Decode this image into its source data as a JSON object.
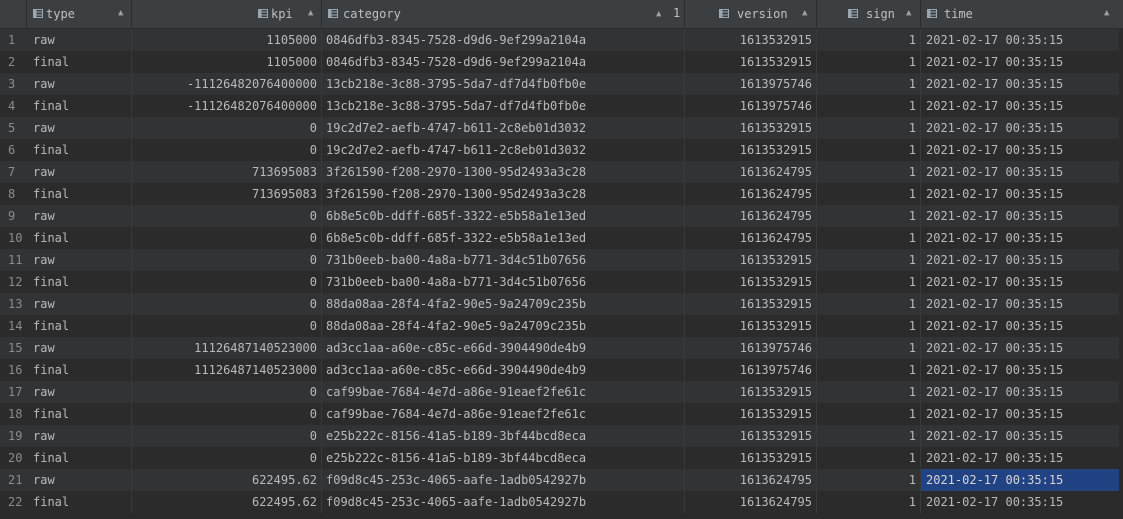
{
  "colors": {
    "background": "#2b2b2b",
    "row_alt": "#313335",
    "header": "#3c3f41",
    "selection": "#214283",
    "text": "#bababa",
    "row_number": "#8c8c8c"
  },
  "headers": {
    "type": "type",
    "kpi": "kpi",
    "category": "category",
    "version": "version",
    "sign": "sign",
    "time": "time",
    "sort_order": "1",
    "column_icon": "table-column-icon",
    "sort_icon": "sort-arrows-icon",
    "sort_asc_icon": "sort-ascending-icon"
  },
  "rows": [
    {
      "n": "1",
      "type": "raw",
      "kpi": "1105000",
      "category": "0846dfb3-8345-7528-d9d6-9ef299a2104a",
      "version": "1613532915",
      "sign": "1",
      "time": "2021-02-17 00:35:15"
    },
    {
      "n": "2",
      "type": "final",
      "kpi": "1105000",
      "category": "0846dfb3-8345-7528-d9d6-9ef299a2104a",
      "version": "1613532915",
      "sign": "1",
      "time": "2021-02-17 00:35:15"
    },
    {
      "n": "3",
      "type": "raw",
      "kpi": "-11126482076400000",
      "category": "13cb218e-3c88-3795-5da7-df7d4fb0fb0e",
      "version": "1613975746",
      "sign": "1",
      "time": "2021-02-17 00:35:15"
    },
    {
      "n": "4",
      "type": "final",
      "kpi": "-11126482076400000",
      "category": "13cb218e-3c88-3795-5da7-df7d4fb0fb0e",
      "version": "1613975746",
      "sign": "1",
      "time": "2021-02-17 00:35:15"
    },
    {
      "n": "5",
      "type": "raw",
      "kpi": "0",
      "category": "19c2d7e2-aefb-4747-b611-2c8eb01d3032",
      "version": "1613532915",
      "sign": "1",
      "time": "2021-02-17 00:35:15"
    },
    {
      "n": "6",
      "type": "final",
      "kpi": "0",
      "category": "19c2d7e2-aefb-4747-b611-2c8eb01d3032",
      "version": "1613532915",
      "sign": "1",
      "time": "2021-02-17 00:35:15"
    },
    {
      "n": "7",
      "type": "raw",
      "kpi": "713695083",
      "category": "3f261590-f208-2970-1300-95d2493a3c28",
      "version": "1613624795",
      "sign": "1",
      "time": "2021-02-17 00:35:15"
    },
    {
      "n": "8",
      "type": "final",
      "kpi": "713695083",
      "category": "3f261590-f208-2970-1300-95d2493a3c28",
      "version": "1613624795",
      "sign": "1",
      "time": "2021-02-17 00:35:15"
    },
    {
      "n": "9",
      "type": "raw",
      "kpi": "0",
      "category": "6b8e5c0b-ddff-685f-3322-e5b58a1e13ed",
      "version": "1613624795",
      "sign": "1",
      "time": "2021-02-17 00:35:15"
    },
    {
      "n": "10",
      "type": "final",
      "kpi": "0",
      "category": "6b8e5c0b-ddff-685f-3322-e5b58a1e13ed",
      "version": "1613624795",
      "sign": "1",
      "time": "2021-02-17 00:35:15"
    },
    {
      "n": "11",
      "type": "raw",
      "kpi": "0",
      "category": "731b0eeb-ba00-4a8a-b771-3d4c51b07656",
      "version": "1613532915",
      "sign": "1",
      "time": "2021-02-17 00:35:15"
    },
    {
      "n": "12",
      "type": "final",
      "kpi": "0",
      "category": "731b0eeb-ba00-4a8a-b771-3d4c51b07656",
      "version": "1613532915",
      "sign": "1",
      "time": "2021-02-17 00:35:15"
    },
    {
      "n": "13",
      "type": "raw",
      "kpi": "0",
      "category": "88da08aa-28f4-4fa2-90e5-9a24709c235b",
      "version": "1613532915",
      "sign": "1",
      "time": "2021-02-17 00:35:15"
    },
    {
      "n": "14",
      "type": "final",
      "kpi": "0",
      "category": "88da08aa-28f4-4fa2-90e5-9a24709c235b",
      "version": "1613532915",
      "sign": "1",
      "time": "2021-02-17 00:35:15"
    },
    {
      "n": "15",
      "type": "raw",
      "kpi": "11126487140523000",
      "category": "ad3cc1aa-a60e-c85c-e66d-3904490de4b9",
      "version": "1613975746",
      "sign": "1",
      "time": "2021-02-17 00:35:15"
    },
    {
      "n": "16",
      "type": "final",
      "kpi": "11126487140523000",
      "category": "ad3cc1aa-a60e-c85c-e66d-3904490de4b9",
      "version": "1613975746",
      "sign": "1",
      "time": "2021-02-17 00:35:15"
    },
    {
      "n": "17",
      "type": "raw",
      "kpi": "0",
      "category": "caf99bae-7684-4e7d-a86e-91eaef2fe61c",
      "version": "1613532915",
      "sign": "1",
      "time": "2021-02-17 00:35:15"
    },
    {
      "n": "18",
      "type": "final",
      "kpi": "0",
      "category": "caf99bae-7684-4e7d-a86e-91eaef2fe61c",
      "version": "1613532915",
      "sign": "1",
      "time": "2021-02-17 00:35:15"
    },
    {
      "n": "19",
      "type": "raw",
      "kpi": "0",
      "category": "e25b222c-8156-41a5-b189-3bf44bcd8eca",
      "version": "1613532915",
      "sign": "1",
      "time": "2021-02-17 00:35:15"
    },
    {
      "n": "20",
      "type": "final",
      "kpi": "0",
      "category": "e25b222c-8156-41a5-b189-3bf44bcd8eca",
      "version": "1613532915",
      "sign": "1",
      "time": "2021-02-17 00:35:15"
    },
    {
      "n": "21",
      "type": "raw",
      "kpi": "622495.62",
      "category": "f09d8c45-253c-4065-aafe-1adb0542927b",
      "version": "1613624795",
      "sign": "1",
      "time": "2021-02-17 00:35:15",
      "selected": true
    },
    {
      "n": "22",
      "type": "final",
      "kpi": "622495.62",
      "category": "f09d8c45-253c-4065-aafe-1adb0542927b",
      "version": "1613624795",
      "sign": "1",
      "time": "2021-02-17 00:35:15"
    }
  ]
}
